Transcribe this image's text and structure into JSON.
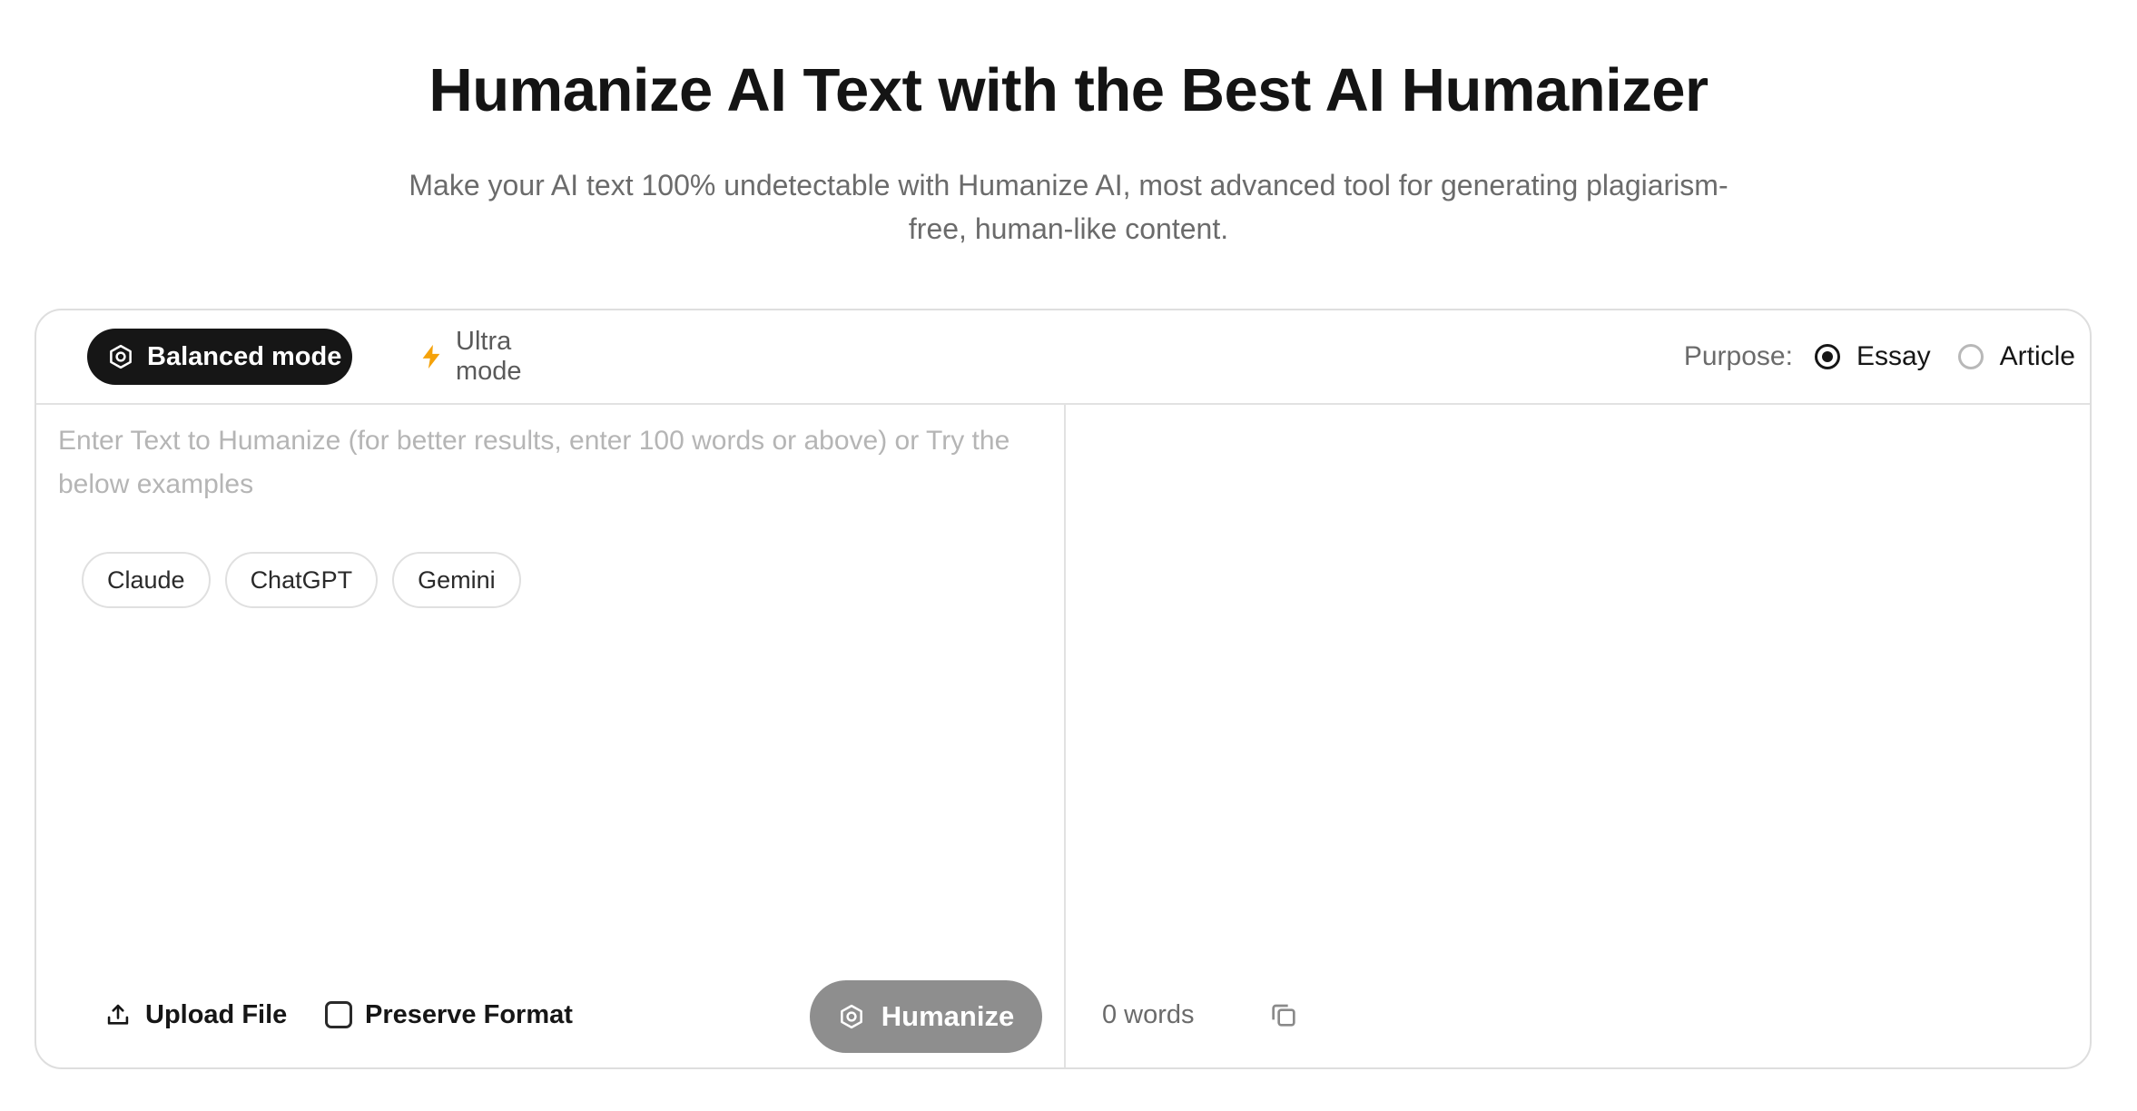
{
  "hero": {
    "title": "Humanize AI Text with the Best AI Humanizer",
    "subtitle": "Make your AI text 100% undetectable with Humanize AI, most advanced tool for generating plagiarism-free, human-like content."
  },
  "modes": {
    "balanced_label": "Balanced mode",
    "ultra_label": "Ultra mode",
    "selected": "Balanced mode"
  },
  "purpose": {
    "label": "Purpose:",
    "options": [
      "Essay",
      "Article"
    ],
    "selected": "Essay"
  },
  "input": {
    "placeholder": "Enter Text to Humanize (for better results, enter 100 words or above) or Try the below examples",
    "value": ""
  },
  "examples": [
    "Claude",
    "ChatGPT",
    "Gemini"
  ],
  "left_footer": {
    "upload_label": "Upload File",
    "preserve_label": "Preserve Format",
    "humanize_label": "Humanize"
  },
  "output": {
    "word_count": "0 words"
  },
  "colors": {
    "primary_dark": "#161616",
    "ultra_accent": "#f5a20a",
    "disabled_button": "#8e8e8e",
    "border": "#dedede"
  },
  "icons": {
    "balanced": "hexagon-mode-icon",
    "ultra": "lightning-icon",
    "upload": "upload-icon",
    "humanize": "hexagon-mode-icon",
    "copy": "copy-icon"
  }
}
